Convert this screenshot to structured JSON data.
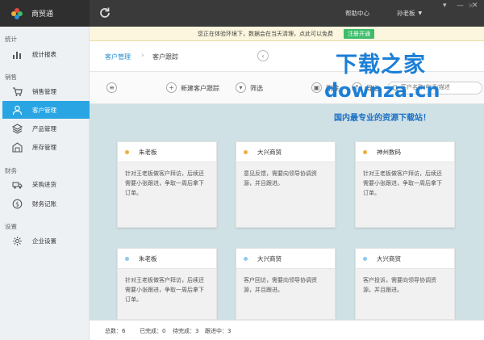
{
  "app": {
    "name": "商贸通"
  },
  "topbar": {
    "help": "帮助中心",
    "user": "孙老板"
  },
  "sidebar": {
    "groups": [
      {
        "title": "统计",
        "items": [
          {
            "label": "统计报表",
            "icon": "bar-chart-icon"
          }
        ]
      },
      {
        "title": "销售",
        "items": [
          {
            "label": "销售管理",
            "icon": "cart-icon"
          },
          {
            "label": "客户管理",
            "icon": "user-icon",
            "active": true
          },
          {
            "label": "产品管理",
            "icon": "layers-icon"
          },
          {
            "label": "库存管理",
            "icon": "warehouse-icon"
          }
        ]
      },
      {
        "title": "财务",
        "items": [
          {
            "label": "采购进货",
            "icon": "truck-icon"
          },
          {
            "label": "财务记账",
            "icon": "coin-icon"
          }
        ]
      },
      {
        "title": "设置",
        "items": [
          {
            "label": "企业设置",
            "icon": "gear-icon"
          }
        ]
      }
    ]
  },
  "notice": {
    "text": "您正在体验环境下，数据会在当天清理，点此可以免费",
    "button": "注册开通"
  },
  "breadcrumb": {
    "parent": "客户管理",
    "current": "客户跟踪"
  },
  "toolbar": {
    "new_label": "新建客户跟踪",
    "filter_label": "筛选",
    "delete_label": "删除",
    "export_label": "导出",
    "search_placeholder": "客户名称/电话/描述"
  },
  "cards": [
    {
      "name": "朱老板",
      "dot": "#f0ad3c",
      "text": "针对王老板做客户拜访，后续还需要小张跟进，争取一周后拿下订单。"
    },
    {
      "name": "大兴商贸",
      "dot": "#f0ad3c",
      "text": "意见反馈，需要向领导协调资源，并且跟进。"
    },
    {
      "name": "神州数码",
      "dot": "#f0ad3c",
      "text": "针对王老板做客户拜访，后续还需要小张跟进，争取一周后拿下订单。"
    },
    {
      "name": "朱老板",
      "dot": "#8ec9ee",
      "text": "针对王老板做客户拜访，后续还需要小张跟进，争取一周后拿下订单。"
    },
    {
      "name": "大兴商贸",
      "dot": "#8ec9ee",
      "text": "客户回访，需要向领导协调资源，并且跟进。"
    },
    {
      "name": "大兴商贸",
      "dot": "#8ec9ee",
      "text": "客户投诉，需要向领导协调资源，并且跟进。"
    }
  ],
  "status": {
    "total": "总数：6",
    "done": "已完成：0",
    "pending": "待完成：3",
    "following": "跟进中：3"
  },
  "watermark": {
    "line1": "下载之家",
    "line2": "downza.cn",
    "line3": "国内最专业的资源下载站！"
  }
}
